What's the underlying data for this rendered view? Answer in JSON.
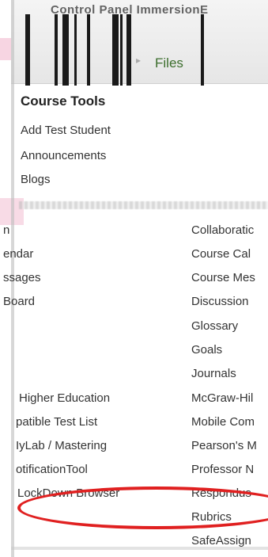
{
  "header": {
    "title": "Control Panel  ImmersionE",
    "files_tab": "Files"
  },
  "course_tools": {
    "heading": "Course Tools",
    "top_items": [
      "Add Test Student",
      "Announcements",
      "Blogs"
    ]
  },
  "tool_columns": {
    "left": [
      "n",
      "endar",
      "ssages",
      "Board",
      "Higher Education",
      "patible Test List",
      "IyLab / Mastering",
      "otificationTool",
      "LockDown Browser"
    ],
    "right": [
      "Collaboratic",
      "Course Cal",
      "Course Mes",
      "Discussion",
      "Glossary",
      "Goals",
      "Journals",
      "McGraw-Hil",
      "Mobile Com",
      "Pearson's M",
      "Professor N",
      "Respondus",
      "Rubrics",
      "SafeAssign"
    ]
  },
  "colors": {
    "files_tab": "#3c6e2d",
    "highlight": "#e02020"
  }
}
